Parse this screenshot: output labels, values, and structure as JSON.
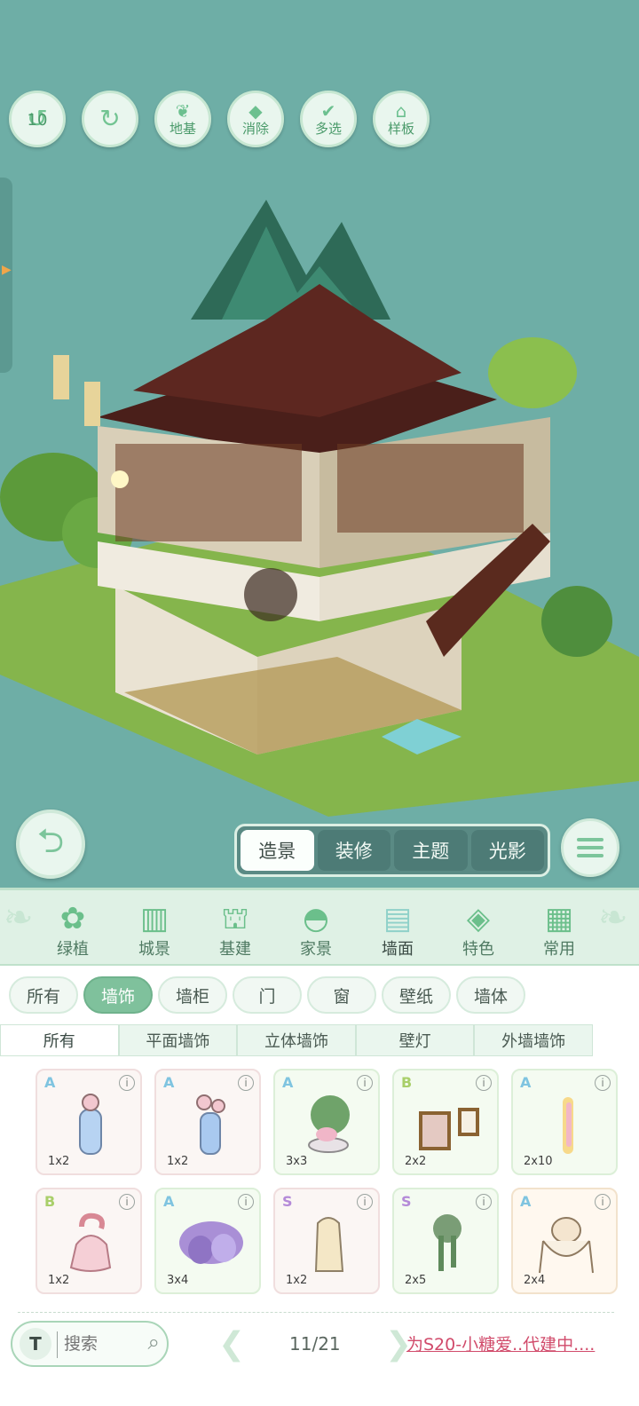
{
  "toolbar": {
    "undo_count": "10",
    "buttons": [
      {
        "icon": "undo-icon",
        "label": ""
      },
      {
        "icon": "redo-icon",
        "label": ""
      },
      {
        "icon": "foundation-icon",
        "label": "地基"
      },
      {
        "icon": "eraser-icon",
        "label": "消除"
      },
      {
        "icon": "multi-select-icon",
        "label": "多选"
      },
      {
        "icon": "template-house-icon",
        "label": "样板"
      }
    ]
  },
  "mode_tabs": [
    "造景",
    "装修",
    "主题",
    "光影"
  ],
  "categories": [
    {
      "label": "绿植",
      "icon": "plant-icon"
    },
    {
      "label": "城景",
      "icon": "city-icon"
    },
    {
      "label": "基建",
      "icon": "construction-icon"
    },
    {
      "label": "家景",
      "icon": "home-view-icon"
    },
    {
      "label": "墙面",
      "icon": "wall-icon"
    },
    {
      "label": "特色",
      "icon": "feature-icon"
    },
    {
      "label": "常用",
      "icon": "calendar-icon"
    }
  ],
  "sub_tabs": [
    "所有",
    "墙饰",
    "墙柜",
    "门",
    "窗",
    "壁纸",
    "墙体"
  ],
  "sub_tabs_2": [
    "所有",
    "平面墙饰",
    "立体墙饰",
    "壁灯",
    "外墙墙饰"
  ],
  "items": [
    {
      "grade": "A",
      "size": "1x2",
      "icon": "blue-wall-bottle-icon"
    },
    {
      "grade": "A",
      "size": "1x2",
      "icon": "blue-wall-vase-icon"
    },
    {
      "grade": "A",
      "size": "3x3",
      "icon": "potted-plant-icon"
    },
    {
      "grade": "B",
      "size": "2x2",
      "icon": "wall-frames-icon"
    },
    {
      "grade": "A",
      "size": "2x10",
      "icon": "hanging-flowers-icon"
    },
    {
      "grade": "B",
      "size": "1x2",
      "icon": "pink-wall-lamp-icon"
    },
    {
      "grade": "A",
      "size": "3x4",
      "icon": "purple-wisteria-icon"
    },
    {
      "grade": "S",
      "size": "1x2",
      "icon": "cream-curtain-icon"
    },
    {
      "grade": "S",
      "size": "2x5",
      "icon": "vine-plant-icon"
    },
    {
      "grade": "A",
      "size": "2x4",
      "icon": "cat-hammock-icon"
    }
  ],
  "colors": {
    "grade_A": "#7fc4e0",
    "grade_B": "#a9cf6a",
    "grade_S": "#b48ad8"
  },
  "search": {
    "placeholder": "搜索"
  },
  "pagination": {
    "current": "11/21"
  },
  "status_text": "为S20-小糖爱..代建中...."
}
